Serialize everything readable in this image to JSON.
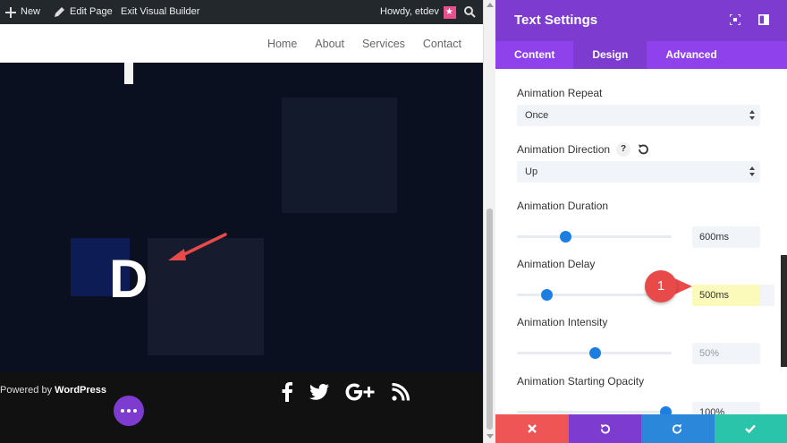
{
  "admin_bar": {
    "new_label": "New",
    "edit_page_label": "Edit Page",
    "exit_label": "Exit Visual Builder",
    "howdy_label": "Howdy, etdev"
  },
  "site": {
    "nav": [
      "Home",
      "About",
      "Services",
      "Contact"
    ],
    "hero_letter": "D",
    "footer": {
      "powered_prefix": "Powered by ",
      "powered_brand": "WordPress"
    },
    "social_icons": [
      "facebook-icon",
      "twitter-icon",
      "google-plus-icon",
      "rss-icon"
    ]
  },
  "panel": {
    "title": "Text Settings",
    "tabs": [
      {
        "label": "Content",
        "active": false
      },
      {
        "label": "Design",
        "active": true
      },
      {
        "label": "Advanced",
        "active": false
      }
    ],
    "fields": {
      "repeat": {
        "label": "Animation Repeat",
        "value": "Once"
      },
      "direction": {
        "label": "Animation Direction",
        "help": "?",
        "value": "Up"
      },
      "duration": {
        "label": "Animation Duration",
        "value": "600ms",
        "slider_pct": 31
      },
      "delay": {
        "label": "Animation Delay",
        "value": "500ms",
        "slider_pct": 19
      },
      "intensity": {
        "label": "Animation Intensity",
        "value": "50%",
        "slider_pct": 50
      },
      "opacity": {
        "label": "Animation Starting Opacity",
        "value": "100%",
        "slider_pct": 96
      }
    }
  },
  "callout": {
    "number": "1"
  },
  "colors": {
    "purple": "#7e3bd0",
    "tab_bar": "#8f42ec",
    "discard": "#ef5555",
    "redo": "#2b87da",
    "save": "#29c4a9",
    "slider": "#1d7ee2",
    "callout": "#e84a4a"
  }
}
